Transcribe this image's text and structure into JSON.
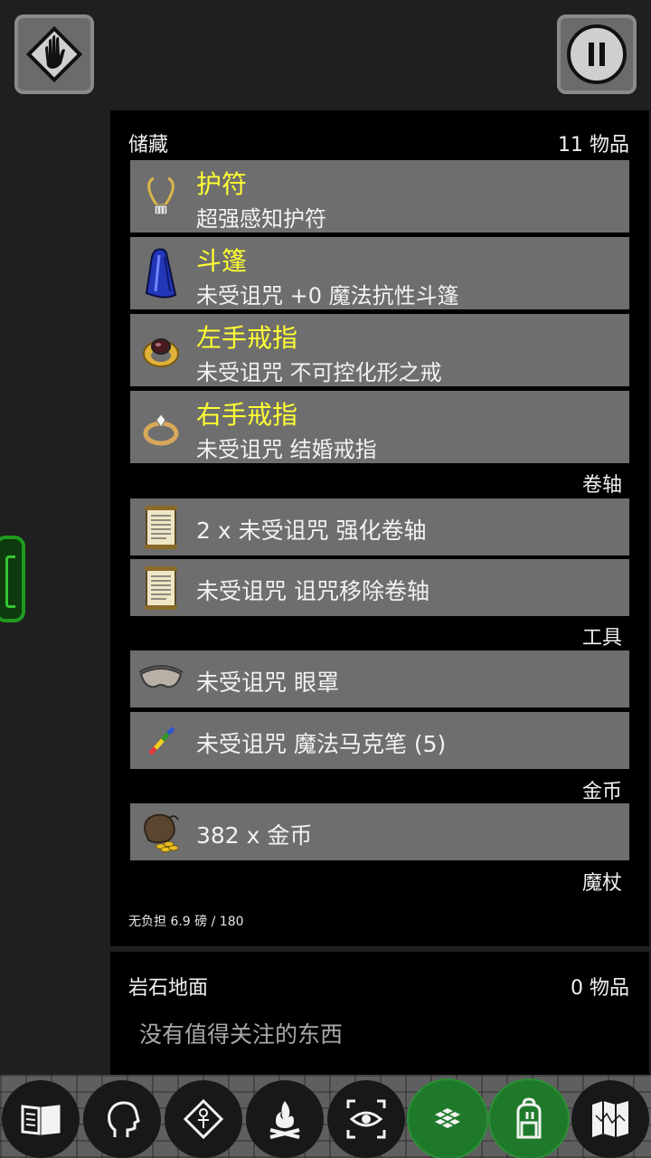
{
  "top_left_icon": "hand-stop-icon",
  "top_right_icon": "pause-icon",
  "inventory": {
    "title": "储藏",
    "count": "11 物品",
    "worn": [
      {
        "slot": "护符",
        "desc": "超强感知护符",
        "icon": "amulet-icon"
      },
      {
        "slot": "斗篷",
        "desc": "未受诅咒 +0 魔法抗性斗篷",
        "icon": "cloak-icon"
      },
      {
        "slot": "左手戒指",
        "desc": "未受诅咒 不可控化形之戒",
        "icon": "ruby-ring-icon"
      },
      {
        "slot": "右手戒指",
        "desc": "未受诅咒 结婚戒指",
        "icon": "diamond-ring-icon"
      }
    ],
    "sections": [
      {
        "label": "卷轴",
        "items": [
          {
            "desc": "2 x 未受诅咒 强化卷轴",
            "icon": "scroll-icon"
          },
          {
            "desc": "未受诅咒 诅咒移除卷轴",
            "icon": "scroll-icon"
          }
        ]
      },
      {
        "label": "工具",
        "items": [
          {
            "desc": "未受诅咒 眼罩",
            "icon": "blindfold-icon"
          },
          {
            "desc": "未受诅咒 魔法马克笔 (5)",
            "icon": "marker-icon"
          }
        ]
      },
      {
        "label": "金币",
        "items": [
          {
            "desc": "382 x 金币",
            "icon": "gold-bag-icon"
          }
        ]
      },
      {
        "label": "魔杖",
        "items": []
      }
    ],
    "burden": "无负担 6.9 磅 / 180"
  },
  "floor": {
    "title": "岩石地面",
    "count": "0 物品",
    "empty_text": "没有值得关注的东西"
  },
  "toolbar": [
    {
      "icon": "spellbook-icon",
      "active": false
    },
    {
      "icon": "head-profile-icon",
      "active": false
    },
    {
      "icon": "ankh-diamond-icon",
      "active": false
    },
    {
      "icon": "campfire-icon",
      "active": false
    },
    {
      "icon": "eye-scan-icon",
      "active": false
    },
    {
      "icon": "floor-tiles-icon",
      "active": true
    },
    {
      "icon": "backpack-icon",
      "active": true
    },
    {
      "icon": "map-icon",
      "active": false
    }
  ]
}
